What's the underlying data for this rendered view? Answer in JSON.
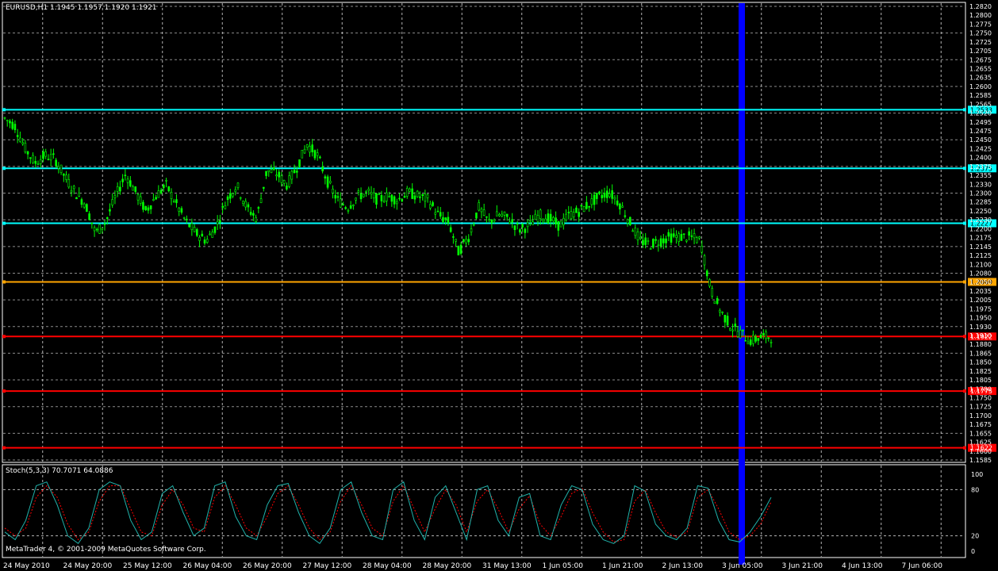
{
  "window": {
    "header_text": "EURUSD,H1  1.1945 1.1957 1.1920 1.1921",
    "footer_text": "MetaTrader 4, © 2001-2009 MetaQuotes Software Corp."
  },
  "colors": {
    "background": "#000000",
    "grid": "#ffffff",
    "candle": "#00ff00",
    "stoch_main": "#20b2aa",
    "stoch_signal": "#ff0000",
    "vertical_band": "#0000ff",
    "axis_text": "#ffffff"
  },
  "price_axis": {
    "tick_labels": [
      "1.2820",
      "1.2800",
      "1.2775",
      "1.2750",
      "1.2725",
      "1.2705",
      "1.2675",
      "1.2655",
      "1.2635",
      "1.2600",
      "1.2585",
      "1.2565",
      "1.2520",
      "1.2495",
      "1.2475",
      "1.2450",
      "1.2425",
      "1.2400",
      "1.2375",
      "1.2355",
      "1.2330",
      "1.2300",
      "1.2285",
      "1.2250",
      "1.2230",
      "1.2200",
      "1.2175",
      "1.2145",
      "1.2125",
      "1.2100",
      "1.2080",
      "1.2050",
      "1.2035",
      "1.2005",
      "1.1975",
      "1.1950",
      "1.1930",
      "1.1910",
      "1.1880",
      "1.1865",
      "1.1850",
      "1.1825",
      "1.1805",
      "1.1780",
      "1.1750",
      "1.1725",
      "1.1700",
      "1.1675",
      "1.1655",
      "1.1625",
      "1.1600",
      "1.1585"
    ]
  },
  "levels": [
    {
      "label": "1.2533",
      "color": "#00ffff",
      "text_color": "#000000"
    },
    {
      "label": "1.2375",
      "color": "#00ffff",
      "text_color": "#000000"
    },
    {
      "label": "1.2227",
      "color": "#00ffff",
      "text_color": "#000000"
    },
    {
      "label": "1.2069",
      "color": "#ffa500",
      "text_color": "#000000"
    },
    {
      "label": "1.1922",
      "color": "#ff0000",
      "text_color": "#ffffff"
    },
    {
      "label": "1.1775",
      "color": "#ff0000",
      "text_color": "#ffffff"
    },
    {
      "label": "1.1622",
      "color": "#ff0000",
      "text_color": "#ffffff"
    }
  ],
  "time_axis": {
    "labels": [
      "24 May 2010",
      "24 May 20:00",
      "25 May 12:00",
      "26 May 04:00",
      "26 May 20:00",
      "27 May 12:00",
      "28 May 04:00",
      "28 May 20:00",
      "31 May 13:00",
      "1 Jun 05:00",
      "1 Jun 21:00",
      "2 Jun 13:00",
      "3 Jun 05:00",
      "3 Jun 21:00",
      "4 Jun 13:00",
      "7 Jun 06:00"
    ]
  },
  "indicator": {
    "title": "Stoch(5,3,3) 70.7071 64.0886",
    "scale_labels": [
      "100",
      "80",
      "20",
      "0"
    ]
  },
  "chart_data": {
    "type": "candlestick",
    "symbol": "EURUSD",
    "timeframe": "H1",
    "ohlc_last": {
      "open": 1.1945,
      "high": 1.1957,
      "low": 1.192,
      "close": 1.1921
    },
    "ylim": [
      1.1585,
      1.282
    ],
    "horizontal_levels": [
      1.2533,
      1.2375,
      1.2227,
      1.2069,
      1.1922,
      1.1775,
      1.1622
    ],
    "x_labels": [
      "24 May 2010",
      "24 May 20:00",
      "25 May 12:00",
      "26 May 04:00",
      "26 May 20:00",
      "27 May 12:00",
      "28 May 04:00",
      "28 May 20:00",
      "31 May 13:00",
      "1 Jun 05:00",
      "1 Jun 21:00",
      "2 Jun 13:00",
      "3 Jun 05:00",
      "3 Jun 21:00",
      "4 Jun 13:00",
      "7 Jun 06:00"
    ],
    "price_path_estimate": [
      1.251,
      1.249,
      1.243,
      1.239,
      1.241,
      1.24,
      1.235,
      1.231,
      1.228,
      1.22,
      1.223,
      1.23,
      1.236,
      1.231,
      1.226,
      1.23,
      1.233,
      1.228,
      1.223,
      1.22,
      1.218,
      1.222,
      1.229,
      1.233,
      1.227,
      1.224,
      1.237,
      1.236,
      1.233,
      1.238,
      1.244,
      1.241,
      1.234,
      1.229,
      1.227,
      1.23,
      1.231,
      1.229,
      1.23,
      1.229,
      1.231,
      1.23,
      1.229,
      1.225,
      1.223,
      1.215,
      1.219,
      1.227,
      1.223,
      1.225,
      1.224,
      1.221,
      1.222,
      1.225,
      1.224,
      1.222,
      1.225,
      1.226,
      1.228,
      1.23,
      1.231,
      1.228,
      1.223,
      1.218,
      1.217,
      1.218,
      1.219,
      1.219,
      1.219,
      1.218,
      1.205,
      1.199,
      1.195,
      1.193,
      1.191,
      1.192,
      1.1921
    ],
    "stochastic": {
      "name": "Stoch(5,3,3)",
      "main_last": 70.7071,
      "signal_last": 64.0886,
      "ylim": [
        0,
        100
      ],
      "levels": [
        80,
        20
      ],
      "main_estimate": [
        25,
        15,
        40,
        85,
        90,
        60,
        20,
        10,
        30,
        80,
        90,
        85,
        40,
        15,
        25,
        75,
        85,
        50,
        20,
        30,
        85,
        90,
        45,
        20,
        15,
        60,
        85,
        88,
        50,
        20,
        10,
        30,
        80,
        90,
        50,
        20,
        15,
        80,
        90,
        40,
        15,
        70,
        85,
        50,
        15,
        80,
        85,
        40,
        20,
        70,
        75,
        20,
        15,
        60,
        85,
        80,
        35,
        15,
        10,
        20,
        85,
        78,
        35,
        20,
        15,
        30,
        85,
        82,
        40,
        15,
        12,
        25,
        45,
        70
      ],
      "signal_estimate": [
        30,
        20,
        30,
        70,
        85,
        70,
        35,
        15,
        25,
        65,
        85,
        85,
        55,
        25,
        20,
        60,
        80,
        60,
        30,
        25,
        70,
        85,
        60,
        30,
        20,
        45,
        75,
        85,
        60,
        30,
        15,
        25,
        65,
        85,
        60,
        30,
        20,
        65,
        85,
        55,
        25,
        55,
        80,
        60,
        25,
        65,
        80,
        55,
        25,
        55,
        72,
        35,
        20,
        45,
        75,
        82,
        50,
        25,
        12,
        15,
        65,
        80,
        50,
        25,
        18,
        25,
        70,
        80,
        55,
        25,
        15,
        20,
        35,
        64
      ]
    }
  }
}
